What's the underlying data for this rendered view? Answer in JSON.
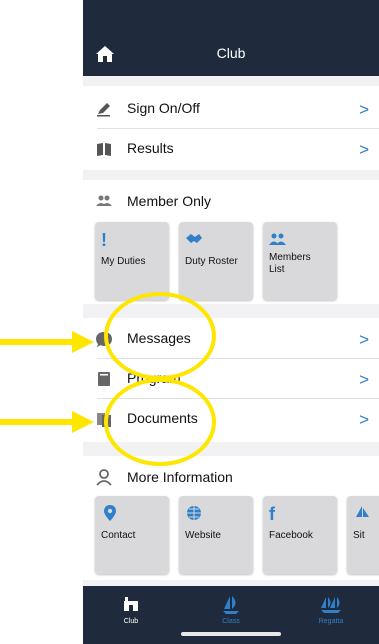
{
  "header": {
    "title": "Club"
  },
  "menu1": {
    "sign_on_off": "Sign On/Off",
    "results": "Results"
  },
  "member_only": {
    "title": "Member Only",
    "tiles": [
      "My Duties",
      "Duty Roster",
      "Members\nList"
    ]
  },
  "menu2": {
    "messages": "Messages",
    "program": "Program",
    "documents": "Documents"
  },
  "more_info": {
    "title": "More Information",
    "tiles": [
      "Contact",
      "Website",
      "Facebook",
      "Sit"
    ]
  },
  "bottom_nav": {
    "club": "Club",
    "class": "Class",
    "regatta": "Regatta"
  },
  "colors": {
    "navy": "#1f2b3d",
    "accent": "#2f80c8",
    "highlight": "#ffe600"
  }
}
